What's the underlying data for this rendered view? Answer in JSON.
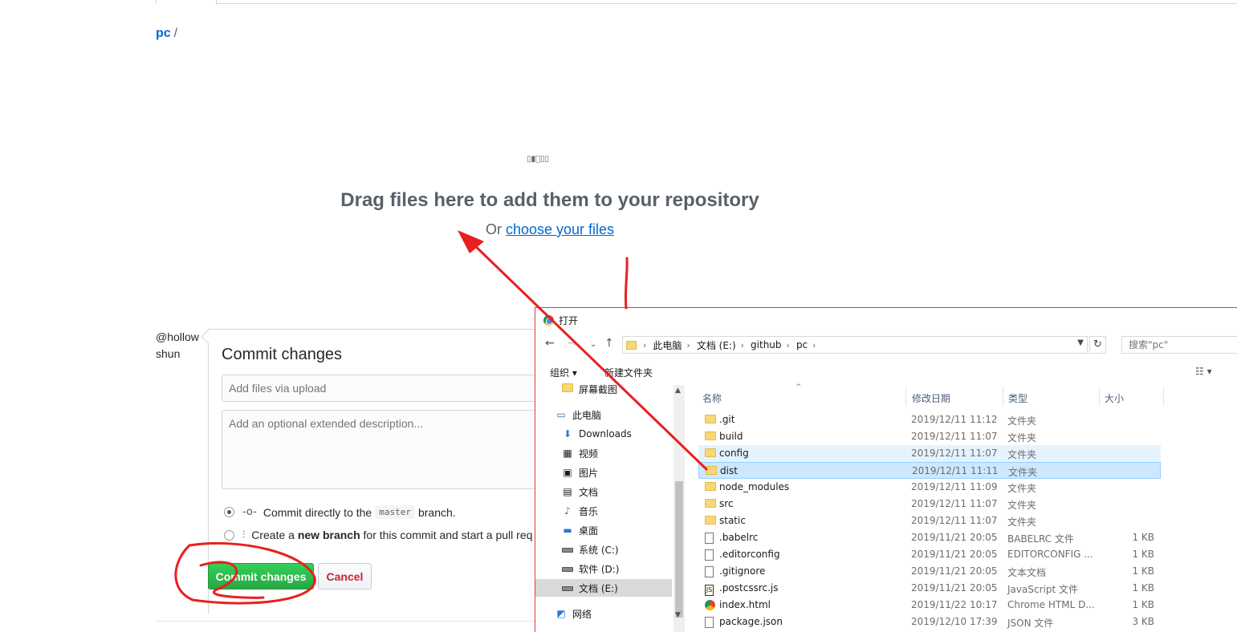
{
  "breadcrumb": {
    "repo": "pc",
    "separator": "/"
  },
  "dropzone": {
    "icons_text": "▯▮⃝▯▯",
    "title": "Drag files here to add them to your repository",
    "or_text": "Or",
    "choose_link": "choose your files"
  },
  "commit": {
    "avatar_alt": "@hollowshun",
    "heading": "Commit changes",
    "summary_placeholder": "Add files via upload",
    "description_placeholder": "Add an optional extended description...",
    "option_direct_prefix": "Commit directly to the",
    "branch_name": "master",
    "option_direct_suffix": "branch.",
    "option_new_prefix": "Create a",
    "option_new_bold": "new branch",
    "option_new_suffix": "for this commit and start a pull req",
    "commit_button": "Commit changes",
    "cancel_button": "Cancel"
  },
  "dialog": {
    "title": "打开",
    "path": [
      "此电脑",
      "文档 (E:)",
      "github",
      "pc"
    ],
    "search_placeholder": "搜索\"pc\"",
    "toolbar": {
      "organize": "组织 ▾",
      "new_folder": "新建文件夹"
    },
    "nav_items": [
      {
        "label": "屏幕截图",
        "icon": "folder-icon"
      },
      {
        "label": "此电脑",
        "icon": "computer-icon"
      },
      {
        "label": "Downloads",
        "icon": "download-icon"
      },
      {
        "label": "视频",
        "icon": "video-icon"
      },
      {
        "label": "图片",
        "icon": "picture-icon"
      },
      {
        "label": "文档",
        "icon": "document-icon"
      },
      {
        "label": "音乐",
        "icon": "music-icon"
      },
      {
        "label": "桌面",
        "icon": "desktop-icon"
      },
      {
        "label": "系统 (C:)",
        "icon": "drive-icon"
      },
      {
        "label": "软件 (D:)",
        "icon": "drive-icon"
      },
      {
        "label": "文档 (E:)",
        "icon": "drive-icon"
      },
      {
        "label": "网络",
        "icon": "network-icon"
      }
    ],
    "columns": {
      "name": "名称",
      "modified": "修改日期",
      "type": "类型",
      "size": "大小"
    },
    "files": [
      {
        "name": ".git",
        "date": "2019/12/11 11:12",
        "type": "文件夹",
        "size": "",
        "icon": "folder-icon"
      },
      {
        "name": "build",
        "date": "2019/12/11 11:07",
        "type": "文件夹",
        "size": "",
        "icon": "folder-icon"
      },
      {
        "name": "config",
        "date": "2019/12/11 11:07",
        "type": "文件夹",
        "size": "",
        "icon": "folder-icon"
      },
      {
        "name": "dist",
        "date": "2019/12/11 11:11",
        "type": "文件夹",
        "size": "",
        "icon": "folder-icon"
      },
      {
        "name": "node_modules",
        "date": "2019/12/11 11:09",
        "type": "文件夹",
        "size": "",
        "icon": "folder-icon"
      },
      {
        "name": "src",
        "date": "2019/12/11 11:07",
        "type": "文件夹",
        "size": "",
        "icon": "folder-icon"
      },
      {
        "name": "static",
        "date": "2019/12/11 11:07",
        "type": "文件夹",
        "size": "",
        "icon": "folder-icon"
      },
      {
        "name": ".babelrc",
        "date": "2019/11/21 20:05",
        "type": "BABELRC 文件",
        "size": "1 KB",
        "icon": "file-icon"
      },
      {
        "name": ".editorconfig",
        "date": "2019/11/21 20:05",
        "type": "EDITORCONFIG ...",
        "size": "1 KB",
        "icon": "file-icon"
      },
      {
        "name": ".gitignore",
        "date": "2019/11/21 20:05",
        "type": "文本文档",
        "size": "1 KB",
        "icon": "file-icon"
      },
      {
        "name": ".postcssrc.js",
        "date": "2019/11/21 20:05",
        "type": "JavaScript 文件",
        "size": "1 KB",
        "icon": "js-file-icon"
      },
      {
        "name": "index.html",
        "date": "2019/11/22 10:17",
        "type": "Chrome HTML D...",
        "size": "1 KB",
        "icon": "chrome-icon"
      },
      {
        "name": "package.json",
        "date": "2019/12/10 17:39",
        "type": "JSON 文件",
        "size": "3 KB",
        "icon": "file-icon"
      }
    ]
  },
  "colors": {
    "annotation": "#e8201f",
    "github_green": "#28a745",
    "link_blue": "#0366d6"
  }
}
